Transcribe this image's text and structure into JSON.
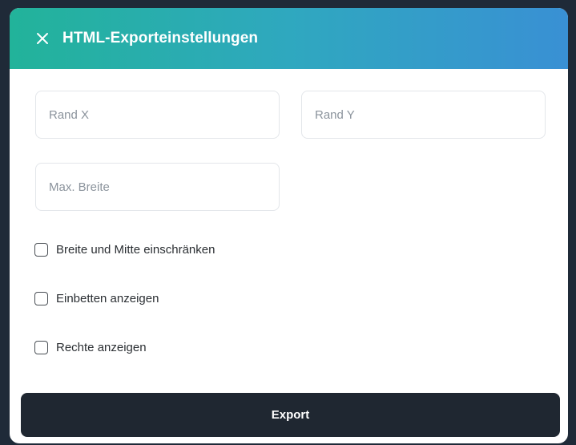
{
  "dialog": {
    "title": "HTML-Exporteinstellungen",
    "close_icon": "close-icon"
  },
  "fields": {
    "margin_x": {
      "placeholder": "Rand X",
      "value": ""
    },
    "margin_y": {
      "placeholder": "Rand Y",
      "value": ""
    },
    "max_width": {
      "placeholder": "Max. Breite",
      "value": ""
    }
  },
  "options": [
    {
      "label": "Breite und Mitte einschränken",
      "checked": false
    },
    {
      "label": "Einbetten anzeigen",
      "checked": false
    },
    {
      "label": "Rechte anzeigen",
      "checked": false
    }
  ],
  "actions": {
    "export_label": "Export"
  },
  "colors": {
    "header_gradient_start": "#22b39a",
    "header_gradient_end": "#3990d4",
    "button_bg": "#1f2731"
  }
}
